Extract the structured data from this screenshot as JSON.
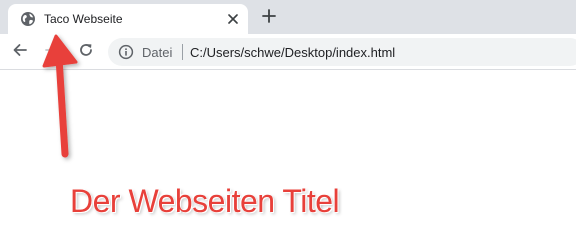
{
  "tab": {
    "title": "Taco Webseite",
    "favicon_icon": "globe-icon",
    "close_icon": "close-icon"
  },
  "new_tab_icon": "plus-icon",
  "toolbar": {
    "back_icon": "back-arrow-icon",
    "forward_icon": "forward-arrow-icon",
    "reload_icon": "reload-icon"
  },
  "omnibox": {
    "info_icon": "info-icon",
    "origin_label": "Datei",
    "url": "C:/Users/schwe/Desktop/index.html"
  },
  "annotation": {
    "label": "Der Webseiten Titel",
    "arrow_icon": "arrow-up-icon",
    "color": "#e8403a"
  }
}
